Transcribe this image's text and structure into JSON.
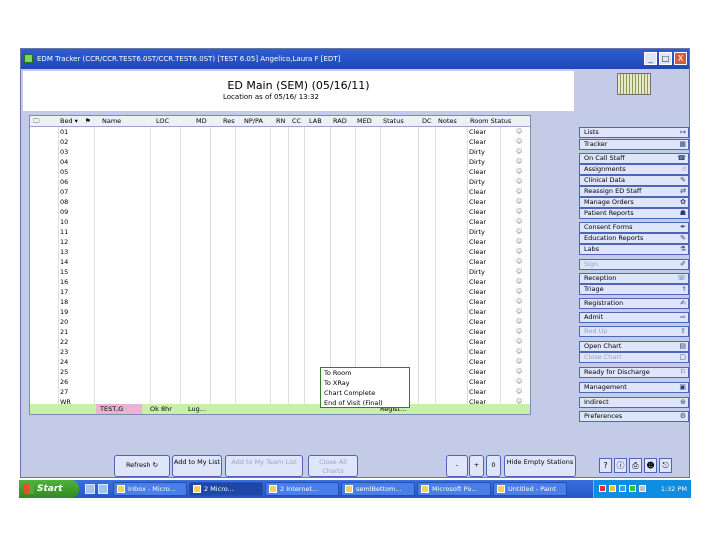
{
  "window": {
    "title": "EDM Tracker   (CCR/CCR.TEST6.0ST/CCR.TEST6.0ST)   [TEST 6.05]   Angelico,Laura F [EDT]",
    "buttons": {
      "minimize": "_",
      "maximize": "□",
      "close": "X"
    }
  },
  "header": {
    "title": "ED Main (SEM) (05/16/11)",
    "subtitle": "Location as of 05/16/    13:32"
  },
  "grid": {
    "columns": [
      "Bed ▾",
      "Name",
      "LOC",
      "MD",
      "Res",
      "NP/PA",
      "RN",
      "CC",
      "LAB",
      "RAD",
      "MED",
      "Status",
      "DC",
      "Notes",
      "Room Status"
    ],
    "rows": [
      {
        "bed": "01",
        "status": "Clear"
      },
      {
        "bed": "02",
        "status": "Clear"
      },
      {
        "bed": "03",
        "status": "Dirty"
      },
      {
        "bed": "04",
        "status": "Dirty"
      },
      {
        "bed": "05",
        "status": "Clear"
      },
      {
        "bed": "06",
        "status": "Dirty"
      },
      {
        "bed": "07",
        "status": "Clear"
      },
      {
        "bed": "08",
        "status": "Clear"
      },
      {
        "bed": "09",
        "status": "Clear"
      },
      {
        "bed": "10",
        "status": "Clear"
      },
      {
        "bed": "11",
        "status": "Dirty"
      },
      {
        "bed": "12",
        "status": "Clear"
      },
      {
        "bed": "13",
        "status": "Clear"
      },
      {
        "bed": "14",
        "status": "Clear"
      },
      {
        "bed": "15",
        "status": "Dirty"
      },
      {
        "bed": "16",
        "status": "Clear"
      },
      {
        "bed": "17",
        "status": "Clear"
      },
      {
        "bed": "18",
        "status": "Clear"
      },
      {
        "bed": "19",
        "status": "Clear"
      },
      {
        "bed": "20",
        "status": "Clear"
      },
      {
        "bed": "21",
        "status": "Clear"
      },
      {
        "bed": "22",
        "status": "Clear"
      },
      {
        "bed": "23",
        "status": "Clear"
      },
      {
        "bed": "24",
        "status": "Clear"
      },
      {
        "bed": "25",
        "status": "Clear"
      },
      {
        "bed": "26",
        "status": "Clear"
      },
      {
        "bed": "27",
        "status": "Clear"
      },
      {
        "bed": "WR",
        "status": "Clear"
      }
    ],
    "footer_row": {
      "name": "TEST,G",
      "loc": "Ok 8hr",
      "md": "Lug...",
      "status": "Regist..."
    },
    "popup_menu": [
      "To Room",
      "To XRay",
      "Chart Complete",
      "End of Visit (Final)"
    ]
  },
  "right_panel": {
    "buttons": [
      {
        "label": "Lists",
        "disabled": false
      },
      {
        "label": "Tracker",
        "disabled": false
      },
      {
        "label": "On Call Staff",
        "disabled": false
      },
      {
        "label": "Assignments",
        "disabled": false
      },
      {
        "label": "Clinical Data",
        "disabled": false
      },
      {
        "label": "Reassign ED Staff",
        "disabled": false
      },
      {
        "label": "Manage Orders",
        "disabled": false
      },
      {
        "label": "Patient Reports",
        "disabled": false
      },
      {
        "label": "Consent Forms",
        "disabled": false
      },
      {
        "label": "Education Reports",
        "disabled": false
      },
      {
        "label": "Labs",
        "disabled": false
      },
      {
        "label": "Sign",
        "disabled": true
      },
      {
        "label": "Reception",
        "disabled": false
      },
      {
        "label": "Triage",
        "disabled": false
      },
      {
        "label": "Registration",
        "disabled": false
      },
      {
        "label": "Admit",
        "disabled": false
      },
      {
        "label": "Bed Up",
        "disabled": true
      },
      {
        "label": "Open Chart",
        "disabled": false
      },
      {
        "label": "Close Chart",
        "disabled": true
      },
      {
        "label": "Ready for Discharge",
        "disabled": false
      },
      {
        "label": "Management",
        "disabled": false
      },
      {
        "label": "Indirect",
        "disabled": false
      },
      {
        "label": "Preferences",
        "disabled": false
      }
    ]
  },
  "toolbar": {
    "refresh": "Refresh",
    "add_to_my_list": "Add to My List",
    "add_to_my_team_list": "Add to My Team List",
    "close_all_charts": "Close All Charts",
    "minus": "-",
    "plus": "+",
    "zero": "0",
    "hide_empty_stations": "Hide Empty Stations"
  },
  "taskbar": {
    "start": "Start",
    "tasks": [
      {
        "label": "Inbox - Micro...",
        "active": false
      },
      {
        "label": "2 Micro...",
        "active": true
      },
      {
        "label": "2 Internet...",
        "active": false
      },
      {
        "label": "semlBettom...",
        "active": false
      },
      {
        "label": "Microsoft Po...",
        "active": false
      },
      {
        "label": "Untitled - Paint",
        "active": false
      }
    ],
    "clock": "1:32 PM"
  }
}
